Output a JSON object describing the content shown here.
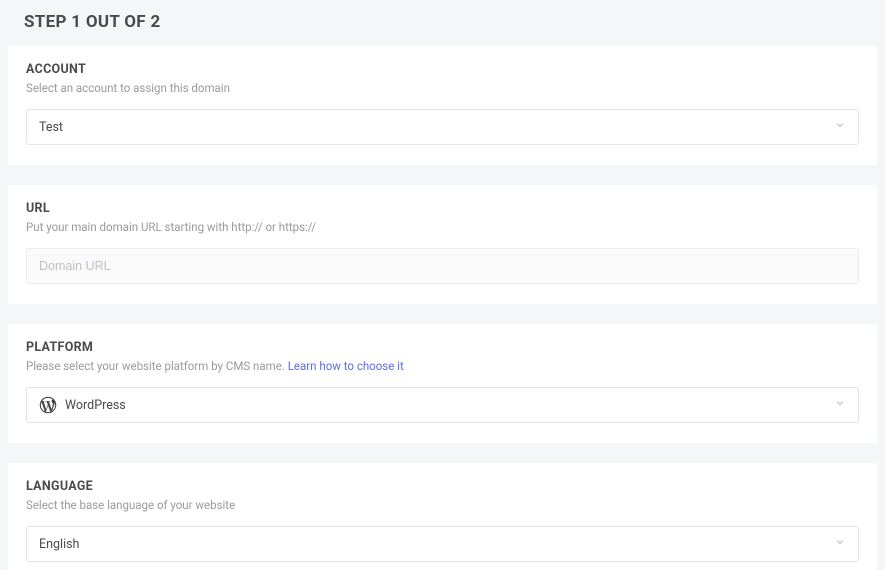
{
  "page": {
    "title": "STEP 1 OUT OF 2"
  },
  "account": {
    "title": "ACCOUNT",
    "desc": "Select an account to assign this domain",
    "value": "Test"
  },
  "url": {
    "title": "URL",
    "desc": "Put your main domain URL starting with http:// or https://",
    "placeholder": "Domain URL"
  },
  "platform": {
    "title": "PLATFORM",
    "desc_prefix": "Please select your website platform by CMS name. ",
    "learn_link": "Learn how to choose it",
    "value": "WordPress"
  },
  "language": {
    "title": "LANGUAGE",
    "desc": "Select the base language of your website",
    "value": "English"
  }
}
